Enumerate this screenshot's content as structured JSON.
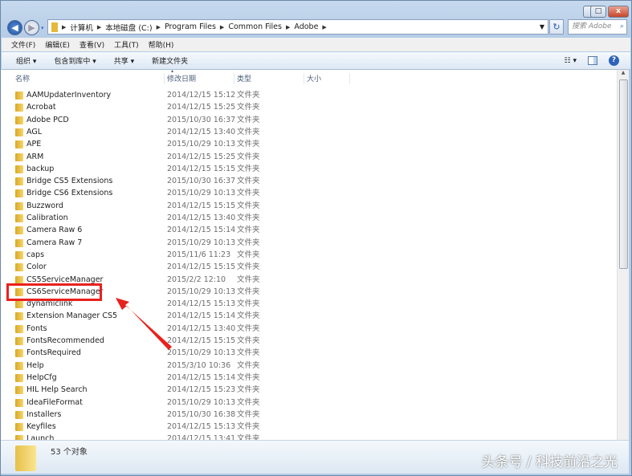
{
  "window": {
    "minimize": "–",
    "maximize": "□",
    "close": "x"
  },
  "address": {
    "crumbs": [
      "计算机",
      "本地磁盘 (C:)",
      "Program Files",
      "Common Files",
      "Adobe"
    ],
    "search_placeholder": "搜索 Adobe"
  },
  "menu": [
    "文件(F)",
    "编辑(E)",
    "查看(V)",
    "工具(T)",
    "帮助(H)"
  ],
  "toolbar": {
    "organize": "组织 ▾",
    "include": "包含到库中 ▾",
    "share": "共享 ▾",
    "new_folder": "新建文件夹",
    "views": "☷ ▾",
    "help": "?"
  },
  "columns": {
    "name": "名称",
    "date": "修改日期",
    "type": "类型",
    "size": "大小"
  },
  "files": [
    {
      "name": "AAMUpdaterInventory",
      "date": "2014/12/15 15:12",
      "type": "文件夹"
    },
    {
      "name": "Acrobat",
      "date": "2014/12/15 15:25",
      "type": "文件夹"
    },
    {
      "name": "Adobe PCD",
      "date": "2015/10/30 16:37",
      "type": "文件夹"
    },
    {
      "name": "AGL",
      "date": "2014/12/15 13:40",
      "type": "文件夹"
    },
    {
      "name": "APE",
      "date": "2015/10/29 10:13",
      "type": "文件夹"
    },
    {
      "name": "ARM",
      "date": "2014/12/15 15:25",
      "type": "文件夹"
    },
    {
      "name": "backup",
      "date": "2014/12/15 15:15",
      "type": "文件夹"
    },
    {
      "name": "Bridge CS5 Extensions",
      "date": "2015/10/30 16:37",
      "type": "文件夹"
    },
    {
      "name": "Bridge CS6 Extensions",
      "date": "2015/10/29 10:13",
      "type": "文件夹"
    },
    {
      "name": "Buzzword",
      "date": "2014/12/15 15:15",
      "type": "文件夹"
    },
    {
      "name": "Calibration",
      "date": "2014/12/15 13:40",
      "type": "文件夹"
    },
    {
      "name": "Camera Raw 6",
      "date": "2014/12/15 15:14",
      "type": "文件夹"
    },
    {
      "name": "Camera Raw 7",
      "date": "2015/10/29 10:13",
      "type": "文件夹"
    },
    {
      "name": "caps",
      "date": "2015/11/6 11:23",
      "type": "文件夹"
    },
    {
      "name": "Color",
      "date": "2014/12/15 15:15",
      "type": "文件夹"
    },
    {
      "name": "CS5ServiceManager",
      "date": "2015/2/2 12:10",
      "type": "文件夹"
    },
    {
      "name": "CS6ServiceManager",
      "date": "2015/10/29 10:13",
      "type": "文件夹"
    },
    {
      "name": "dynamiclink",
      "date": "2014/12/15 15:13",
      "type": "文件夹"
    },
    {
      "name": "Extension Manager CS5",
      "date": "2014/12/15 15:14",
      "type": "文件夹"
    },
    {
      "name": "Fonts",
      "date": "2014/12/15 13:40",
      "type": "文件夹"
    },
    {
      "name": "FontsRecommended",
      "date": "2014/12/15 15:15",
      "type": "文件夹"
    },
    {
      "name": "FontsRequired",
      "date": "2015/10/29 10:13",
      "type": "文件夹"
    },
    {
      "name": "Help",
      "date": "2015/3/10 10:36",
      "type": "文件夹"
    },
    {
      "name": "HelpCfg",
      "date": "2014/12/15 15:14",
      "type": "文件夹"
    },
    {
      "name": "HIL Help Search",
      "date": "2014/12/15 15:23",
      "type": "文件夹"
    },
    {
      "name": "IdeaFileFormat",
      "date": "2015/10/29 10:13",
      "type": "文件夹"
    },
    {
      "name": "Installers",
      "date": "2015/10/30 16:38",
      "type": "文件夹"
    },
    {
      "name": "Keyfiles",
      "date": "2014/12/15 15:13",
      "type": "文件夹"
    },
    {
      "name": "Launch",
      "date": "2014/12/15 13:41",
      "type": "文件夹"
    }
  ],
  "status": {
    "count": "53 个对象"
  },
  "watermark": "头条号 / 科技前沿之光",
  "colors": {
    "highlight": "#e8211d"
  }
}
